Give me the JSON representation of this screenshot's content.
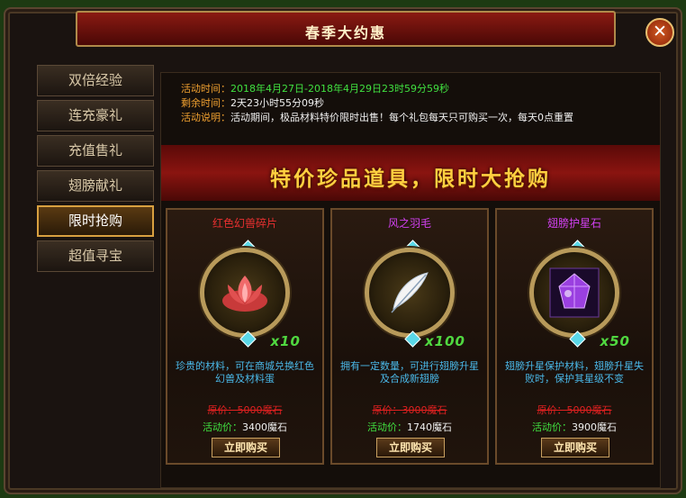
{
  "window": {
    "title": "春季大约惠",
    "close_icon": "close-icon"
  },
  "nav": {
    "items": [
      {
        "label": "双倍经验"
      },
      {
        "label": "连充豪礼"
      },
      {
        "label": "充值售礼"
      },
      {
        "label": "翅膀献礼"
      },
      {
        "label": "限时抢购",
        "active": true
      },
      {
        "label": "超值寻宝"
      }
    ]
  },
  "info": {
    "time_label": "活动时间：",
    "time_value": "2018年4月27日-2018年4月29日23时59分59秒",
    "remaining_label": "剩余时间：",
    "remaining_value": "2天23小时55分09秒",
    "desc_label": "活动说明：",
    "desc_value": "活动期间，极品材料特价限时出售！每个礼包每天只可购买一次，每天0点重置"
  },
  "banner": {
    "text": "特价珍品道具，限时大抢购"
  },
  "items": [
    {
      "name": "红色幻兽碎片",
      "name_color": "#e83030",
      "quantity": "x10",
      "icon": "red-lotus-icon",
      "description": "珍贵的材料，可在商城兑换红色幻兽及材料蛋",
      "original_price": "原价：5000魔石",
      "event_price_label": "活动价：",
      "event_price_value": "3400魔石",
      "buy_label": "立即购买"
    },
    {
      "name": "风之羽毛",
      "name_color": "#d040f0",
      "quantity": "x100",
      "icon": "feather-icon",
      "description": "拥有一定数量，可进行翅膀升星及合成新翅膀",
      "original_price": "原价：3000魔石",
      "event_price_label": "活动价：",
      "event_price_value": "1740魔石",
      "buy_label": "立即购买"
    },
    {
      "name": "翅膀护星石",
      "name_color": "#d040f0",
      "quantity": "x50",
      "icon": "star-stone-icon",
      "description": "翅膀升星保护材料，翅膀升星失败时，保护其星级不变",
      "original_price": "原价：5000魔石",
      "event_price_label": "活动价：",
      "event_price_value": "3900魔石",
      "buy_label": "立即购买"
    }
  ]
}
